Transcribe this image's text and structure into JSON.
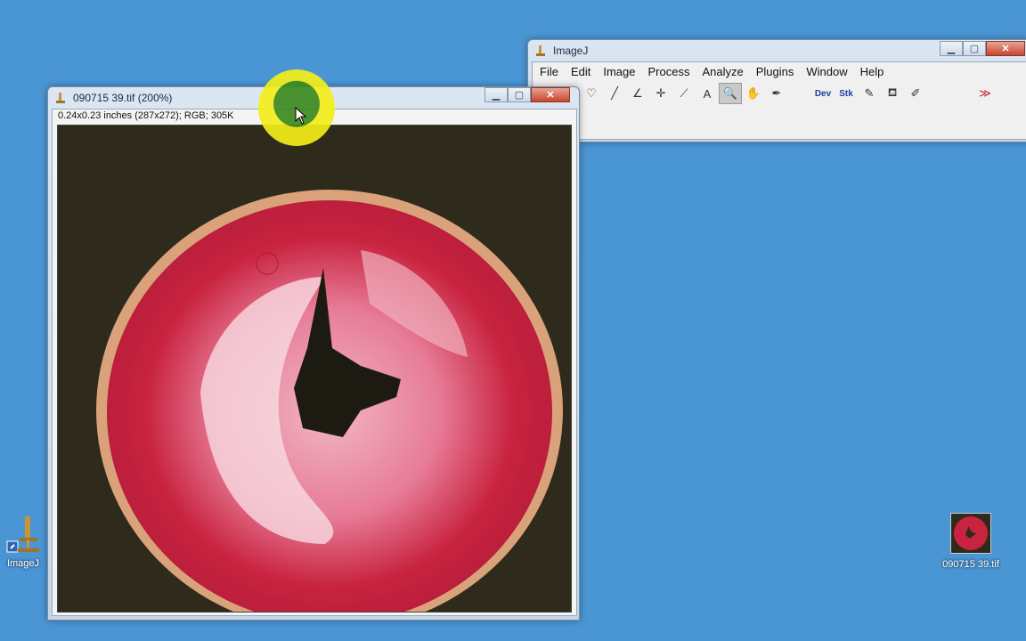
{
  "imagej": {
    "title": "ImageJ",
    "menu": [
      "File",
      "Edit",
      "Image",
      "Process",
      "Analyze",
      "Plugins",
      "Window",
      "Help"
    ],
    "tools": [
      {
        "name": "rectangle-tool-icon",
        "glyph": "▭"
      },
      {
        "name": "polygon-tool-icon",
        "glyph": "⬠"
      },
      {
        "name": "freehand-tool-icon",
        "glyph": "♡"
      },
      {
        "name": "line-tool-icon",
        "glyph": "╱"
      },
      {
        "name": "angle-tool-icon",
        "glyph": "∠"
      },
      {
        "name": "point-tool-icon",
        "glyph": "✛"
      },
      {
        "name": "wand-tool-icon",
        "glyph": "⟋"
      },
      {
        "name": "text-tool-icon",
        "glyph": "A"
      },
      {
        "name": "magnifier-tool-icon",
        "glyph": "🔍"
      },
      {
        "name": "hand-tool-icon",
        "glyph": "✋"
      },
      {
        "name": "dropper-tool-icon",
        "glyph": "✒"
      },
      {
        "name": "blank-tool",
        "glyph": ""
      },
      {
        "name": "dev-menu-tool",
        "glyph": "Dev"
      },
      {
        "name": "stk-menu-tool",
        "glyph": "Stk"
      },
      {
        "name": "brush-tool-icon",
        "glyph": "✎"
      },
      {
        "name": "flood-fill-tool-icon",
        "glyph": "⛾"
      },
      {
        "name": "pencil-tool-icon",
        "glyph": "✐"
      },
      {
        "name": "blank-tool",
        "glyph": ""
      },
      {
        "name": "blank-tool",
        "glyph": ""
      },
      {
        "name": "more-tools-icon",
        "glyph": "≫"
      }
    ]
  },
  "image_window": {
    "title": "090715 39.tif (200%)",
    "info": "0.24x0.23 inches (287x272); RGB; 305K"
  },
  "desktop": {
    "imagej_icon_label": "ImageJ",
    "file_icon_label": "090715 39.tif"
  },
  "colors": {
    "desktop": "#4a95d4",
    "slice_red": "#c8233f",
    "background_dark": "#2e2a1c"
  }
}
